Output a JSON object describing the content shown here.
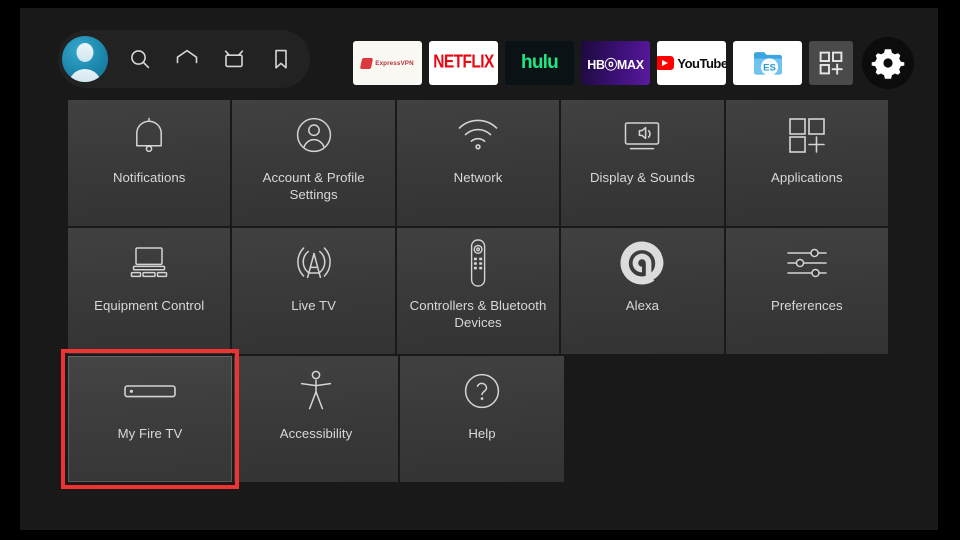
{
  "colors": {
    "background": "#000000",
    "surface": "#191919",
    "tile": "#3c3c3c",
    "nav_pill": "#222222",
    "selection_red": "#f03232",
    "label_text": "#d8d8d8",
    "netflix_red": "#e50914",
    "hulu_green": "#1ce783",
    "youtube_red": "#ff0000",
    "expressvpn_red": "#da3940",
    "avatar_blue": "#1b87ad"
  },
  "topbar": {
    "nav_items": [
      {
        "name": "profile-avatar",
        "label": "Profile",
        "icon": "avatar-icon"
      },
      {
        "name": "search",
        "label": "Search",
        "icon": "search-icon"
      },
      {
        "name": "home",
        "label": "Home",
        "icon": "home-icon"
      },
      {
        "name": "live-tv",
        "label": "Live TV",
        "icon": "tv-icon"
      },
      {
        "name": "watchlist",
        "label": "Watchlist",
        "icon": "bookmark-icon"
      }
    ],
    "apps": [
      {
        "name": "expressvpn",
        "label": "ExpressVPN",
        "wordmark": "ExpressVPN"
      },
      {
        "name": "netflix",
        "label": "Netflix",
        "wordmark": "NETFLIX"
      },
      {
        "name": "hulu",
        "label": "hulu",
        "wordmark": "hulu"
      },
      {
        "name": "hbomax",
        "label": "HBO Max",
        "wordmark": "HBⓞMAX"
      },
      {
        "name": "youtube",
        "label": "YouTube",
        "wordmark": "YouTube"
      },
      {
        "name": "es-file-explorer",
        "label": "ES File Explorer",
        "wordmark": "ES"
      }
    ],
    "apps_grid_button": {
      "label": "Apps",
      "icon": "apps-grid-plus-icon"
    },
    "settings_button": {
      "label": "Settings",
      "icon": "gear-icon"
    }
  },
  "settings_grid": {
    "rows": [
      [
        {
          "id": "notifications",
          "label": "Notifications",
          "icon": "bell-icon",
          "selected": false
        },
        {
          "id": "account-profile-settings",
          "label": "Account & Profile Settings",
          "icon": "person-circle-icon",
          "selected": false
        },
        {
          "id": "network",
          "label": "Network",
          "icon": "wifi-icon",
          "selected": false
        },
        {
          "id": "display-sounds",
          "label": "Display & Sounds",
          "icon": "tv-speaker-icon",
          "selected": false
        },
        {
          "id": "applications",
          "label": "Applications",
          "icon": "apps-grid-plus-icon",
          "selected": false
        }
      ],
      [
        {
          "id": "equipment-control",
          "label": "Equipment Control",
          "icon": "tv-equipment-icon",
          "selected": false
        },
        {
          "id": "live-tv",
          "label": "Live TV",
          "icon": "antenna-icon",
          "selected": false
        },
        {
          "id": "controllers-bluetooth-devices",
          "label": "Controllers & Bluetooth Devices",
          "icon": "remote-icon",
          "selected": false
        },
        {
          "id": "alexa",
          "label": "Alexa",
          "icon": "alexa-ring-icon",
          "selected": false
        },
        {
          "id": "preferences",
          "label": "Preferences",
          "icon": "sliders-icon",
          "selected": false
        }
      ],
      [
        {
          "id": "my-fire-tv",
          "label": "My Fire TV",
          "icon": "fire-tv-stick-icon",
          "selected": true
        },
        {
          "id": "accessibility",
          "label": "Accessibility",
          "icon": "accessibility-icon",
          "selected": false
        },
        {
          "id": "help",
          "label": "Help",
          "icon": "question-circle-icon",
          "selected": false
        }
      ]
    ]
  }
}
